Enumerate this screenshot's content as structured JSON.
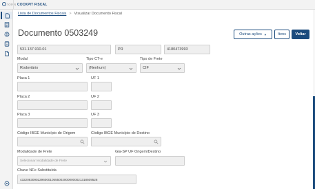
{
  "topbar": {
    "brand": "TOTVS",
    "app_title": "COCKPIT FISCAL"
  },
  "sidebar": {
    "icons": [
      "document-icon",
      "list-icon",
      "coin-icon",
      "calculator-icon",
      "file-icon"
    ],
    "bottom_icon": "help-icon"
  },
  "breadcrumb": {
    "parent": "Lista de Documentos Fiscais",
    "separator": ">",
    "current": "Visualizar Documento Fiscal"
  },
  "header": {
    "title": "Documento 0503249"
  },
  "actions": {
    "more": "Outras ações",
    "itens": "Itens",
    "back": "Voltar"
  },
  "form": {
    "row_top": {
      "v1": "531.137.910-01",
      "v2": "PR",
      "v3": "4180473993"
    },
    "modal": {
      "label": "Modal",
      "value": "Rodoviário"
    },
    "tipo_cte": {
      "label": "Tipo CT-e",
      "value": "(Nenhum)"
    },
    "tipo_frete": {
      "label": "Tipo de Frete",
      "value": "CIF"
    },
    "placa1": {
      "label": "Placa 1",
      "value": ""
    },
    "uf1": {
      "label": "UF 1",
      "value": ""
    },
    "placa2": {
      "label": "Placa 2",
      "value": ""
    },
    "uf2": {
      "label": "UF 2",
      "value": ""
    },
    "placa3": {
      "label": "Placa 3",
      "value": ""
    },
    "uf3": {
      "label": "UF 3",
      "value": ""
    },
    "ibge_origem": {
      "label": "Código IBGE Município de Origem",
      "value": ""
    },
    "ibge_destino": {
      "label": "Código IBGE Município de Destino",
      "value": ""
    },
    "modalidade": {
      "label": "Modalidade de Frete",
      "placeholder": "Selecionar Modalidade de Frete"
    },
    "gia": {
      "label": "Gia-SP UF Origem/Destino",
      "value": ""
    },
    "chave": {
      "label": "Chave NFe Substituída",
      "value": "43220830902296000105550020000000021318509528"
    }
  },
  "colors": {
    "accent": "#1b4b7d",
    "field_bg": "#efefef",
    "border": "#cfcfcf"
  }
}
